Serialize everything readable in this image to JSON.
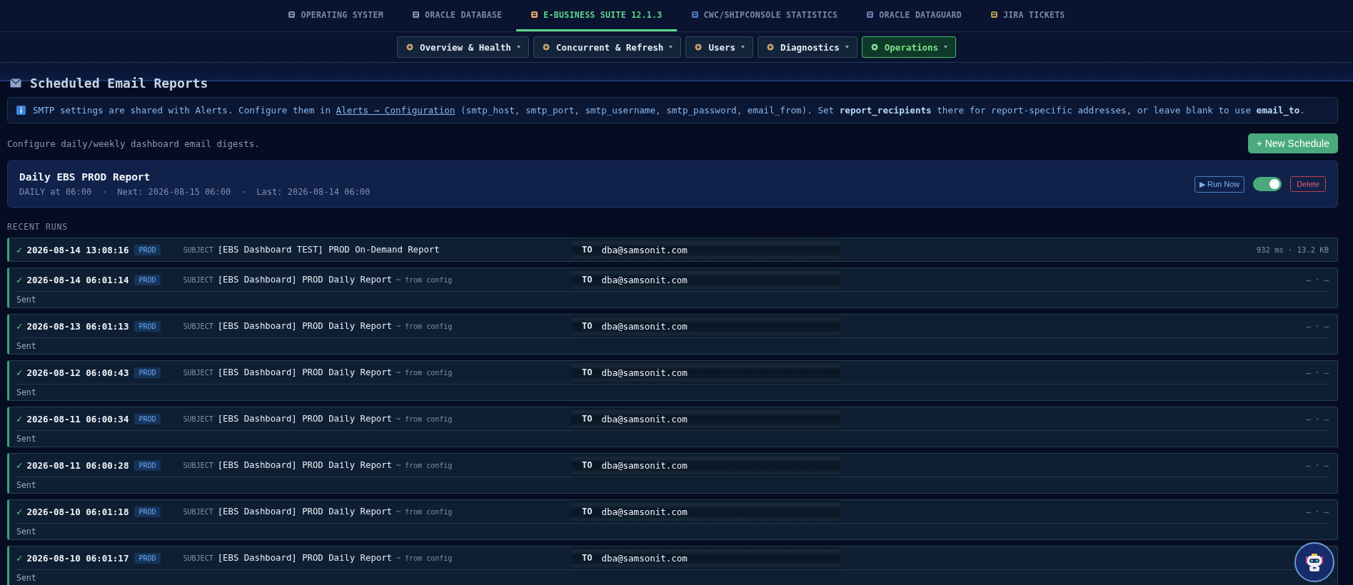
{
  "top_tabs": [
    {
      "label": "OPERATING SYSTEM",
      "selected": false
    },
    {
      "label": "ORACLE DATABASE",
      "selected": false
    },
    {
      "label": "E-BUSINESS SUITE 12.1.3",
      "selected": true
    },
    {
      "label": "CWC/SHIPCONSOLE STATISTICS",
      "selected": false
    },
    {
      "label": "ORACLE DATAGUARD",
      "selected": false
    },
    {
      "label": "JIRA TICKETS",
      "selected": false
    }
  ],
  "sub_tabs": [
    {
      "label": "Overview & Health",
      "selected": false
    },
    {
      "label": "Concurrent & Refresh",
      "selected": false
    },
    {
      "label": "Users",
      "selected": false
    },
    {
      "label": "Diagnostics",
      "selected": false
    },
    {
      "label": "Operations",
      "selected": true
    }
  ],
  "page_title": "Scheduled Email Reports",
  "info": {
    "text": "SMTP settings are shared with Alerts. Configure them in",
    "link": "Alerts → Configuration",
    "rest": "(smtp_host, smtp_port, smtp_username, smtp_password, email_from). Set **report_recipients** there for report-specific addresses, or leave blank to use **email_to**."
  },
  "description": "Configure daily/weekly dashboard email digests.",
  "new_button": "+ New Schedule",
  "schedule": {
    "name": "Daily EBS PROD Report",
    "details": "DAILY at 06:00  ·  Next: 2026-08-15 06:00  ·  Last: 2026-08-14 06:00",
    "run_button": "▶ Run Now",
    "enabled": true,
    "delete_button": "Delete"
  },
  "runs_heading": "RECENT RUNS",
  "runs": [
    {
      "mark": "✓",
      "time": "2026-08-14 13:08:16",
      "env": "PROD",
      "subject_label": "SUBJECT",
      "subject": "[EBS Dashboard TEST] PROD On-Demand Report",
      "to_label": "TO",
      "to": "dba@samsonit.com",
      "meta": "932 ms · 13.2 KB"
    },
    {
      "mark": "✓",
      "time": "2026-08-14 06:01:14",
      "env": "PROD",
      "subject_label": "SUBJECT",
      "subject": "[EBS Dashboard] PROD Daily Report",
      "note": "~ from config",
      "to_label": "TO",
      "to": "dba@samsonit.com",
      "meta": "— · —",
      "status": "Sent"
    },
    {
      "mark": "✓",
      "time": "2026-08-13 06:01:13",
      "env": "PROD",
      "subject_label": "SUBJECT",
      "subject": "[EBS Dashboard] PROD Daily Report",
      "note": "~ from config",
      "to_label": "TO",
      "to": "dba@samsonit.com",
      "meta": "— · —",
      "status": "Sent"
    },
    {
      "mark": "✓",
      "time": "2026-08-12 06:00:43",
      "env": "PROD",
      "subject_label": "SUBJECT",
      "subject": "[EBS Dashboard] PROD Daily Report",
      "note": "~ from config",
      "to_label": "TO",
      "to": "dba@samsonit.com",
      "meta": "— · —",
      "status": "Sent"
    },
    {
      "mark": "✓",
      "time": "2026-08-11 06:00:34",
      "env": "PROD",
      "subject_label": "SUBJECT",
      "subject": "[EBS Dashboard] PROD Daily Report",
      "note": "~ from config",
      "to_label": "TO",
      "to": "dba@samsonit.com",
      "meta": "— · —",
      "status": "Sent"
    },
    {
      "mark": "✓",
      "time": "2026-08-11 06:00:28",
      "env": "PROD",
      "subject_label": "SUBJECT",
      "subject": "[EBS Dashboard] PROD Daily Report",
      "note": "~ from config",
      "to_label": "TO",
      "to": "dba@samsonit.com",
      "meta": "— · —",
      "status": "Sent"
    },
    {
      "mark": "✓",
      "time": "2026-08-10 06:01:18",
      "env": "PROD",
      "subject_label": "SUBJECT",
      "subject": "[EBS Dashboard] PROD Daily Report",
      "note": "~ from config",
      "to_label": "TO",
      "to": "dba@samsonit.com",
      "meta": "— · —",
      "status": "Sent"
    },
    {
      "mark": "✓",
      "time": "2026-08-10 06:01:17",
      "env": "PROD",
      "subject_label": "SUBJECT",
      "subject": "[EBS Dashboard] PROD Daily Report",
      "note": "~ from config",
      "to_label": "TO",
      "to": "dba@samsonit.com",
      "status": "Sent"
    }
  ]
}
